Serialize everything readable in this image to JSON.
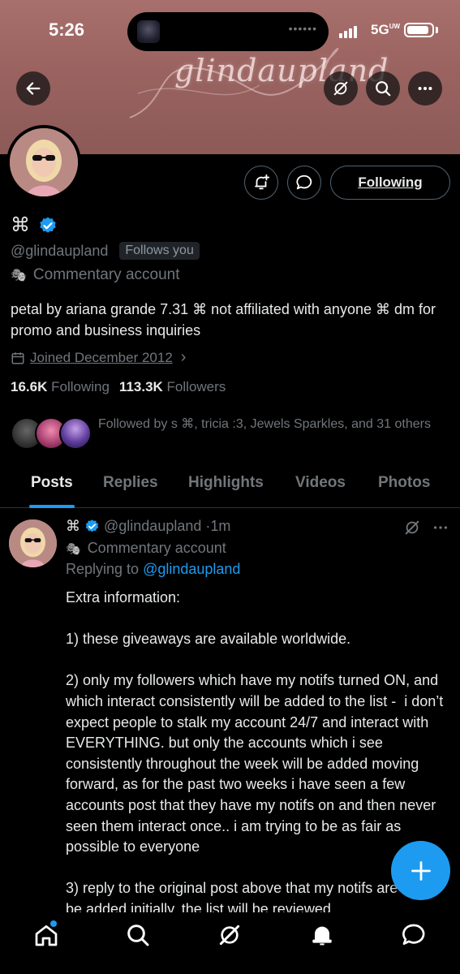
{
  "status_bar": {
    "time": "5:26",
    "network": "5G",
    "network_sub": "UW"
  },
  "banner": {
    "script_text": "glindaupland"
  },
  "profile": {
    "display_name_glyph": "⌘",
    "handle": "@glindaupland",
    "follows_you": "Follows you",
    "label_icon": "🎭",
    "label": "Commentary account",
    "bio": "petal by ariana grande 7.31 ⌘ not affiliated with anyone ⌘ dm for promo and business inquiries",
    "joined": "Joined December 2012",
    "following_count": "16.6K",
    "following_label": "Following",
    "followers_count": "113.3K",
    "followers_label": "Followers",
    "followed_by": "Followed by s ⌘, tricia :3, Jewels Sparkles, and 31 others",
    "following_button": "Following"
  },
  "tabs": [
    "Posts",
    "Replies",
    "Highlights",
    "Videos",
    "Photos"
  ],
  "post": {
    "glyph": "⌘",
    "handle": "@glindaupland",
    "time": "·1m",
    "label": "Commentary account",
    "replying_prefix": "Replying to ",
    "replying_to": "@glindaupland",
    "body": "Extra information:\n\n1) these giveaways are available worldwide.\n\n2) only my followers which have my notifs turned ON, and which interact consistently will be added to the list -  i don’t expect people to stalk my account 24/7 and interact with EVERYTHING. but only the accounts which i see consistently throughout the week will be added moving forward, as for the past two weeks i have seen a few accounts post that they have my notifs on and then never seen them interact once.. i am trying to be as fair as possible to everyone\n\n3) reply to the original post above that my notifs are on to be added initially, the list will be reviewed"
  },
  "colors": {
    "accent": "#1d9bf0",
    "verified": "#1d9bf0",
    "muted": "#71767b",
    "text": "#e7e9ea"
  },
  "icons": {
    "back": "arrow-left-icon",
    "grok": "grok-icon",
    "search": "search-icon",
    "more": "more-icon",
    "notify": "bell-plus-icon",
    "message": "message-icon",
    "calendar": "calendar-icon",
    "home": "home-icon",
    "bell": "bell-icon",
    "compose": "plus-icon"
  }
}
